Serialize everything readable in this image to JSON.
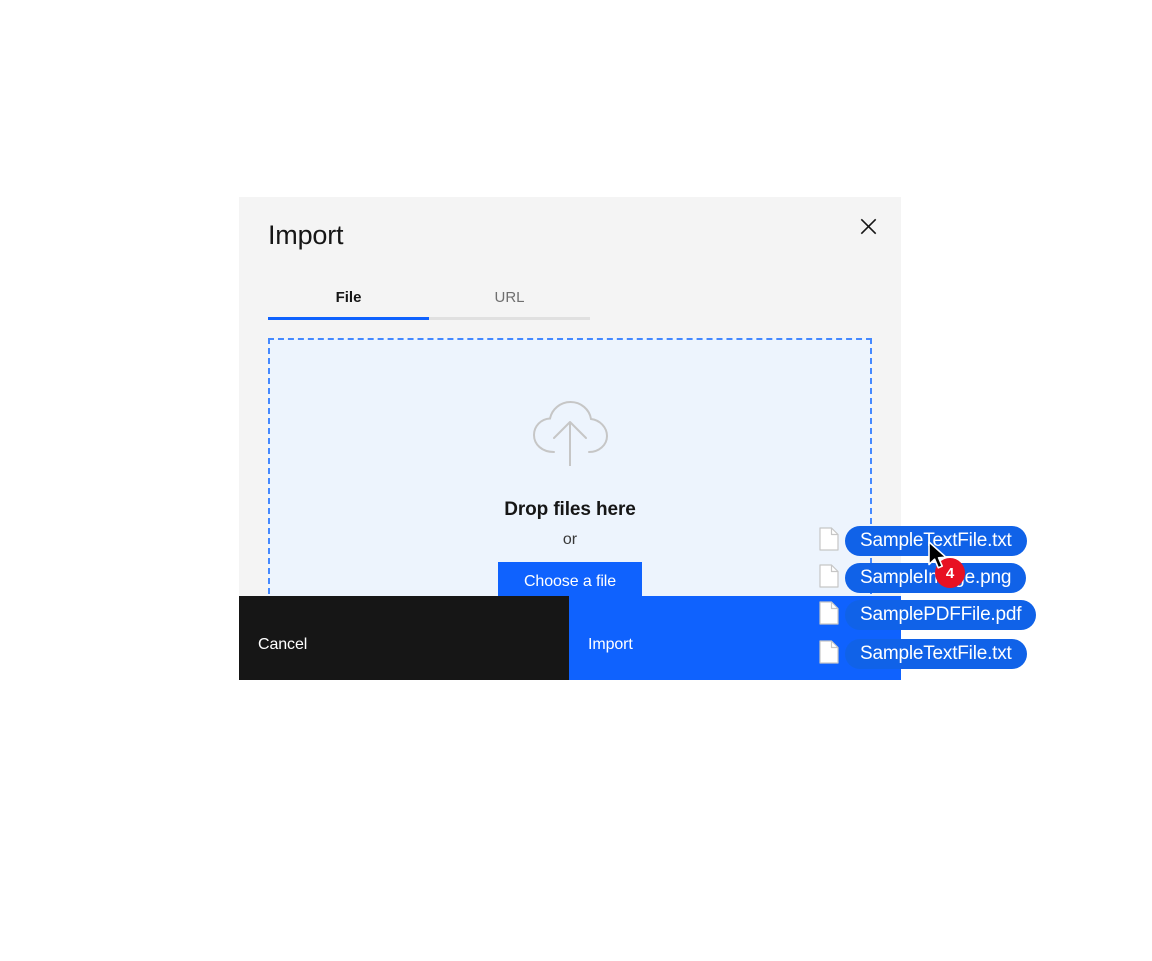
{
  "dialog": {
    "title": "Import",
    "close_icon": "close-icon",
    "tabs": [
      {
        "label": "File",
        "active": true
      },
      {
        "label": "URL",
        "active": false
      }
    ],
    "dropzone": {
      "icon": "cloud-upload-icon",
      "title": "Drop files here",
      "or_label": "or",
      "choose_file_label": "Choose a file"
    },
    "footer": {
      "cancel_label": "Cancel",
      "import_label": "Import"
    }
  },
  "drag": {
    "badge_count": "4",
    "cursor_icon": "arrow-cursor-icon",
    "files": [
      {
        "name": "SampleTextFile.txt",
        "icon": "document-icon"
      },
      {
        "name": "SampleImage.png",
        "icon": "document-icon"
      },
      {
        "name": "SamplePDFFile.pdf",
        "icon": "document-icon"
      },
      {
        "name": "SampleTextFile.txt",
        "icon": "document-icon"
      }
    ]
  },
  "colors": {
    "accent": "#0f62fe",
    "dialog_bg": "#f4f4f4",
    "dropzone_bg": "#edf4fd",
    "dropzone_border": "#4589ff",
    "chip_bg": "#1062e8",
    "badge_bg": "#e81123",
    "cancel_bg": "#161616",
    "page_bg": "#ffffff"
  }
}
